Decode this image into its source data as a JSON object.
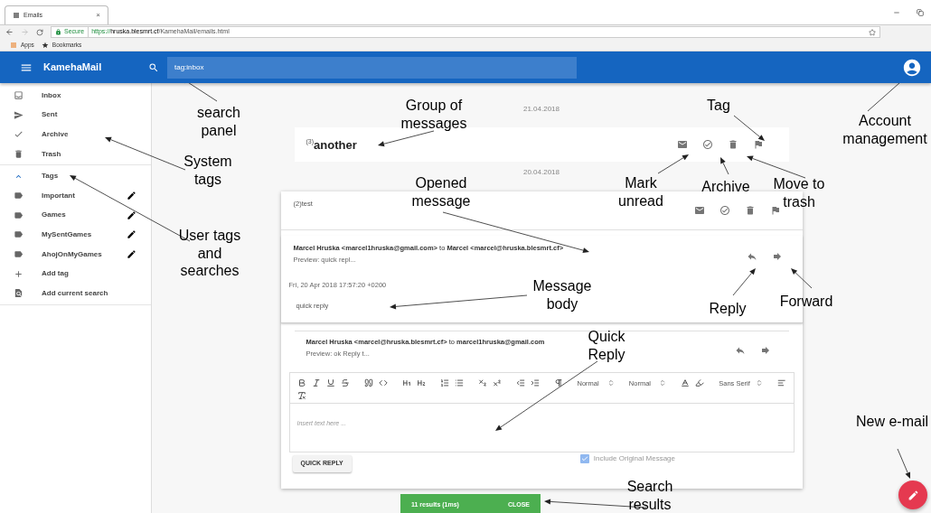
{
  "browser": {
    "tab_title": "Emails",
    "tab_close": "×",
    "secure_label": "Secure",
    "url_scheme": "https://",
    "url_host": "hruska.blesmrt.cf",
    "url_path": "/KamehaMail/emails.html",
    "bookmarks": [
      {
        "label": "Apps",
        "kind": "apps"
      },
      {
        "label": "Bookmarks",
        "kind": "star"
      }
    ]
  },
  "app_bar": {
    "title": "KamehaMail",
    "search_value": "tag:inbox"
  },
  "sidebar": {
    "system_tags": [
      {
        "label": "Inbox",
        "kind": "inbox"
      },
      {
        "label": "Sent",
        "kind": "sent"
      },
      {
        "label": "Archive",
        "kind": "archive"
      },
      {
        "label": "Trash",
        "kind": "trash"
      }
    ],
    "tags_group": {
      "label": "Tags",
      "expanded": true
    },
    "user_tags": [
      {
        "label": "Important"
      },
      {
        "label": "Games"
      },
      {
        "label": "MySentGames"
      },
      {
        "label": "AhojOnMyGames"
      }
    ],
    "actions": [
      {
        "label": "Add tag",
        "kind": "add"
      },
      {
        "label": "Add current search",
        "kind": "search"
      }
    ]
  },
  "groups": [
    {
      "date": "21.04.2018",
      "count": "(3)",
      "subject": "another",
      "expanded": false
    },
    {
      "date": "20.04.2018",
      "count": "(2)",
      "subject": "test",
      "expanded": true,
      "messages": [
        {
          "kind": "open",
          "from_line": "**Marcel Hruška <marcel1hruska@gmail.com>** to **Marcel <marcel@hruska.blesmrt.cf>**",
          "preview": "Preview: quick repl...",
          "date": "Fri, 20 Apr 2018 17:57:20 +0200",
          "body": "quick reply"
        },
        {
          "kind": "reply",
          "from_line": "**Marcel Hruska <marcel@hruska.blesmrt.cf>** to **marcel1hruska@gmail.com**",
          "preview": "Preview: ok Reply t..."
        }
      ]
    }
  ],
  "quick_reply": {
    "dropdowns": [
      {
        "value": "Normal"
      },
      {
        "value": "Normal"
      },
      {
        "value": "Sans Serif"
      }
    ],
    "placeholder": "Insert text here ...",
    "button": "QUICK REPLY",
    "include_original": {
      "label": "Include Original Message",
      "checked": true
    }
  },
  "snackbar": {
    "text": "11 results (1ms)",
    "action": "CLOSE"
  },
  "annotations": [
    {
      "lines": [
        "search",
        "panel"
      ]
    },
    {
      "lines": [
        "Group of",
        "messages"
      ]
    },
    {
      "lines": [
        "Tag"
      ]
    },
    {
      "lines": [
        "Account",
        "management"
      ]
    },
    {
      "lines": [
        "System",
        "tags"
      ]
    },
    {
      "lines": [
        "User tags",
        "and",
        "searches"
      ]
    },
    {
      "lines": [
        "Opened",
        "message"
      ]
    },
    {
      "lines": [
        "Mark",
        "unread"
      ]
    },
    {
      "lines": [
        "Archive"
      ]
    },
    {
      "lines": [
        "Move to",
        "trash"
      ]
    },
    {
      "lines": [
        "Message",
        "body"
      ]
    },
    {
      "lines": [
        "Reply"
      ]
    },
    {
      "lines": [
        "Forward"
      ]
    },
    {
      "lines": [
        "Quick",
        "Reply"
      ]
    },
    {
      "lines": [
        "New e-mail"
      ]
    },
    {
      "lines": [
        "Search",
        "results"
      ]
    }
  ]
}
